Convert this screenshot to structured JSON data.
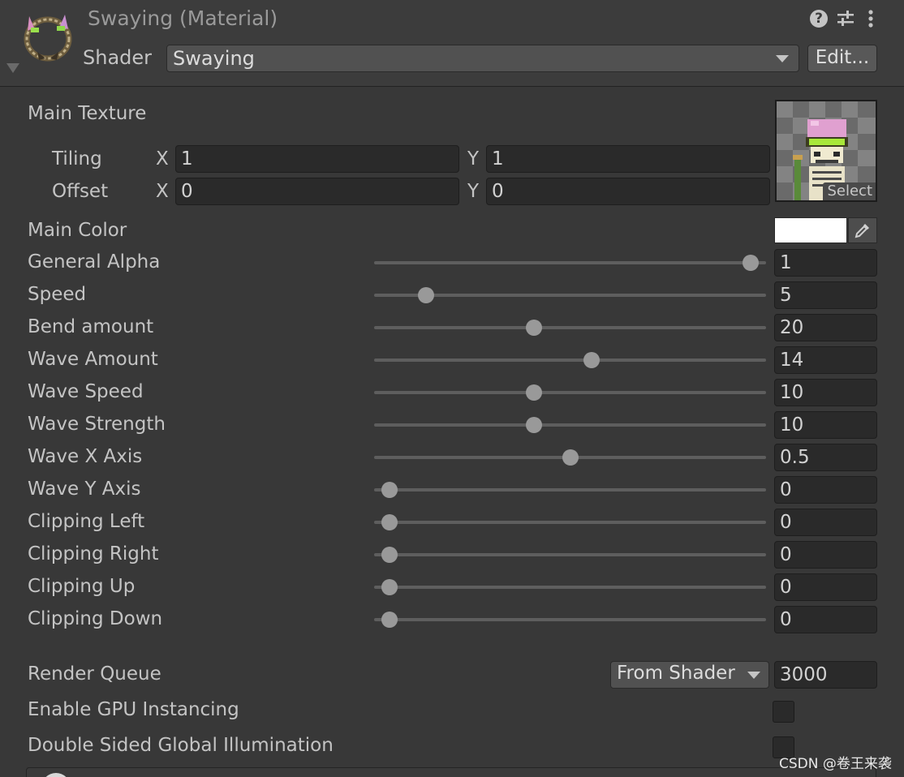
{
  "header": {
    "title": "Swaying (Material)",
    "shader_label": "Shader",
    "shader_value": "Swaying",
    "edit_label": "Edit...",
    "help_icon": "?",
    "icons": [
      "material-preview-icon",
      "help-icon",
      "preset-settings-icon",
      "more-options-icon"
    ]
  },
  "main_texture": {
    "label": "Main Texture",
    "tiling_label": "Tiling",
    "offset_label": "Offset",
    "x_label": "X",
    "y_label": "Y",
    "tiling_x": "1",
    "tiling_y": "1",
    "offset_x": "0",
    "offset_y": "0",
    "select_label": "Select"
  },
  "main_color": {
    "label": "Main Color",
    "value": "#FFFFFF"
  },
  "sliders": [
    {
      "label": "General Alpha",
      "value": "1",
      "fraction": 0.98
    },
    {
      "label": "Speed",
      "value": "5",
      "fraction": 0.116
    },
    {
      "label": "Bend amount",
      "value": "20",
      "fraction": 0.403
    },
    {
      "label": "Wave Amount",
      "value": "14",
      "fraction": 0.557
    },
    {
      "label": "Wave Speed",
      "value": "10",
      "fraction": 0.403
    },
    {
      "label": "Wave Strength",
      "value": "10",
      "fraction": 0.403
    },
    {
      "label": "Wave X Axis",
      "value": "0.5",
      "fraction": 0.5
    },
    {
      "label": "Wave Y Axis",
      "value": "0",
      "fraction": 0.02
    },
    {
      "label": "Clipping Left",
      "value": "0",
      "fraction": 0.02
    },
    {
      "label": "Clipping Right",
      "value": "0",
      "fraction": 0.02
    },
    {
      "label": "Clipping Up",
      "value": "0",
      "fraction": 0.02
    },
    {
      "label": "Clipping Down",
      "value": "0",
      "fraction": 0.02
    }
  ],
  "render_queue": {
    "label": "Render Queue",
    "mode": "From Shader",
    "value": "3000"
  },
  "gpu_instancing": {
    "label": "Enable GPU Instancing",
    "checked": false
  },
  "double_sided_gi": {
    "label": "Double Sided Global Illumination",
    "checked": false
  },
  "watermark": "CSDN @卷王来袭",
  "colors": {
    "background": "#383838",
    "field": "#2a2a2a",
    "text": "#c4c4c4",
    "thumb": "#999999"
  }
}
